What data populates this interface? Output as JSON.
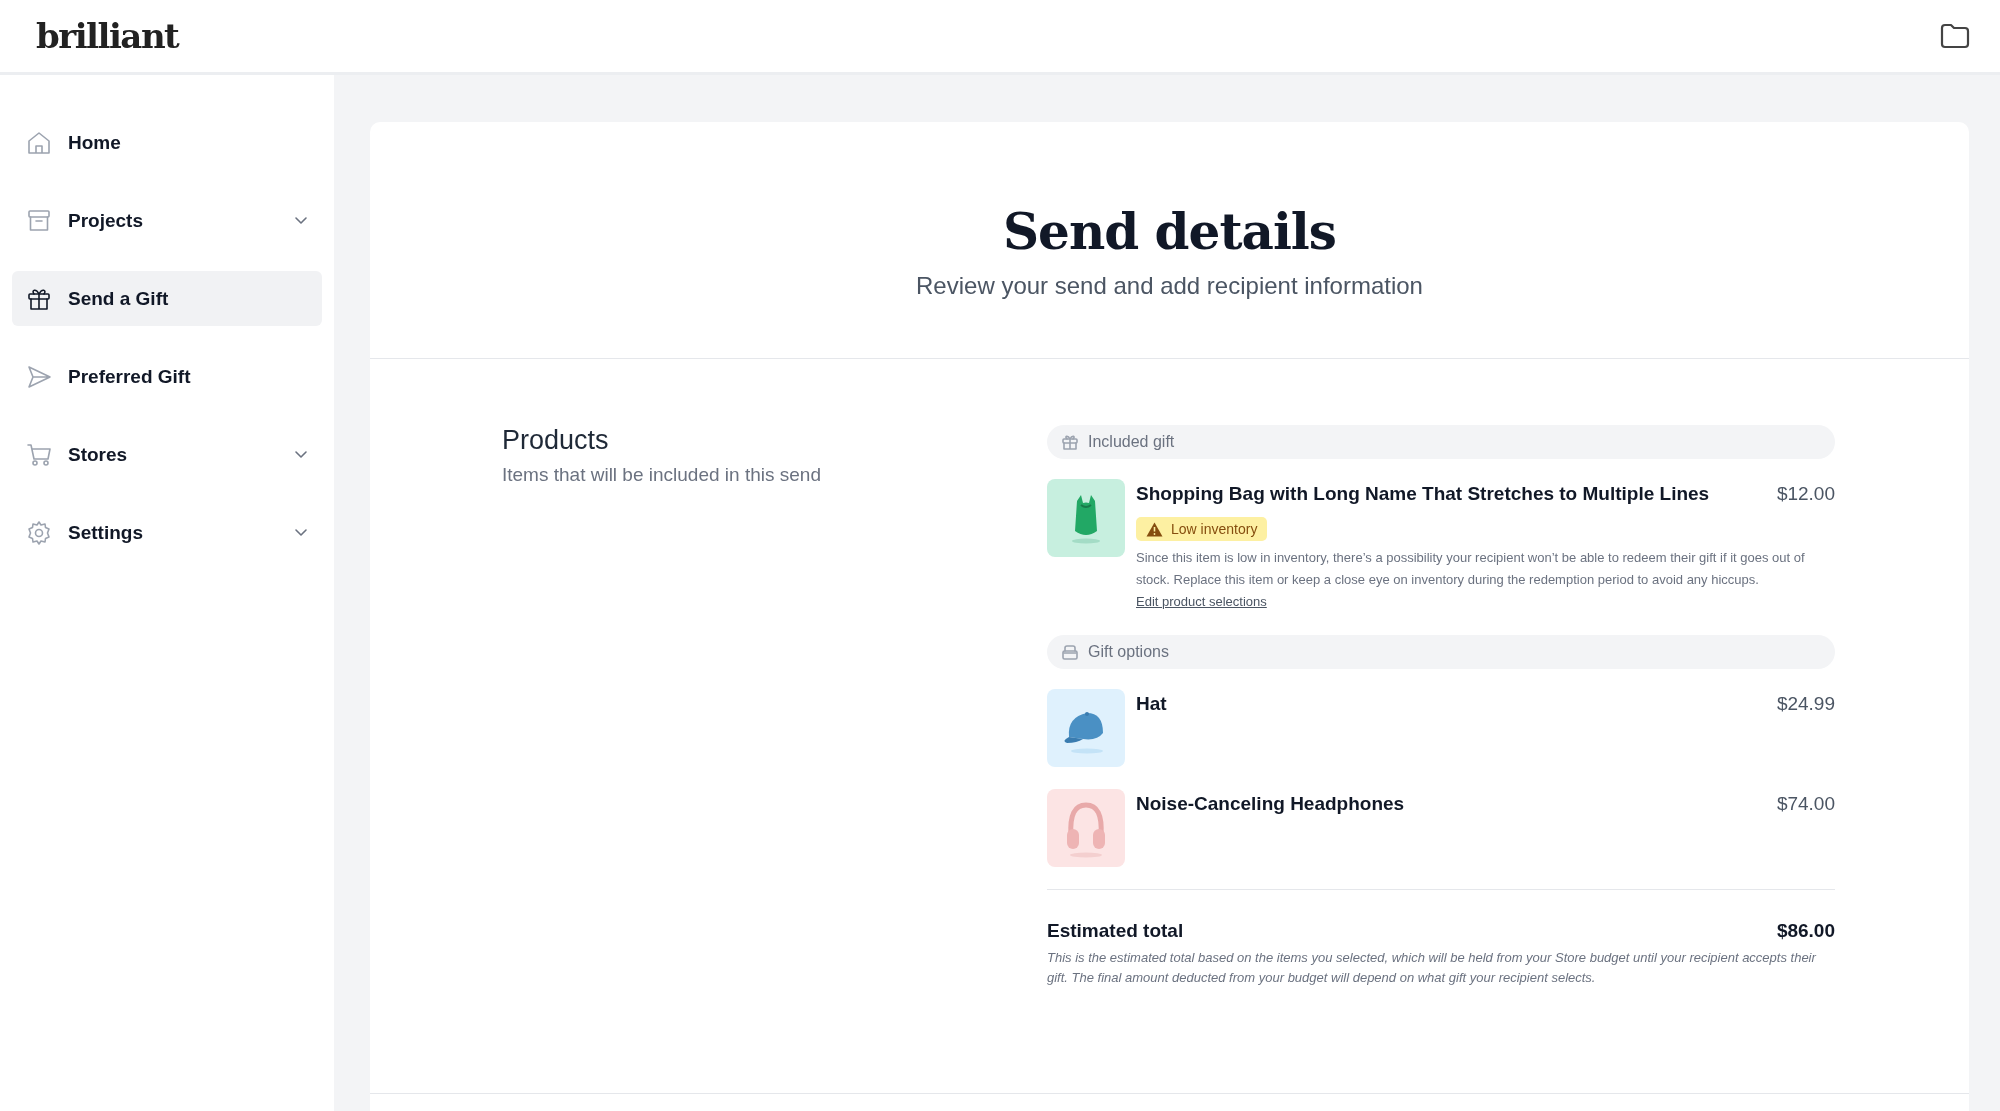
{
  "header": {
    "logo": "brilliant"
  },
  "sidebar": {
    "items": [
      {
        "label": "Home",
        "selected": false,
        "has_submenu": false
      },
      {
        "label": "Projects",
        "selected": false,
        "has_submenu": true
      },
      {
        "label": "Send a Gift",
        "selected": true,
        "has_submenu": false
      },
      {
        "label": "Preferred Gift",
        "selected": false,
        "has_submenu": false
      },
      {
        "label": "Stores",
        "selected": false,
        "has_submenu": true
      },
      {
        "label": "Settings",
        "selected": false,
        "has_submenu": true
      }
    ]
  },
  "page": {
    "title": "Send details",
    "subtitle": "Review your send and add recipient information"
  },
  "products": {
    "title": "Products",
    "description": "Items that will be included in this send",
    "groups": [
      {
        "kind": "included",
        "label": "Included gift",
        "items": [
          {
            "name": "Shopping Bag with Long Name That Stretches to Multiple Lines",
            "price": "$12.00",
            "warning": {
              "badge": "Low inventory",
              "text": "Since this item is low in inventory, there’s a possibility your recipient won’t be able to redeem their gift if it goes out of stock. Replace this item or keep a close eye on inventory during the redemption period to avoid any hiccups.",
              "link": "Edit product selections"
            }
          }
        ]
      },
      {
        "kind": "options",
        "label": "Gift options",
        "items": [
          {
            "name": "Hat",
            "price": "$24.99"
          },
          {
            "name": "Noise-Canceling Headphones",
            "price": "$74.00"
          }
        ]
      }
    ],
    "total": {
      "label": "Estimated total",
      "amount": "$86.00",
      "note": "This is the estimated total based on the items you selected, which will be held from your Store budget until your recipient accepts their gift. The final amount deducted from your budget will depend on what gift your recipient selects."
    }
  }
}
